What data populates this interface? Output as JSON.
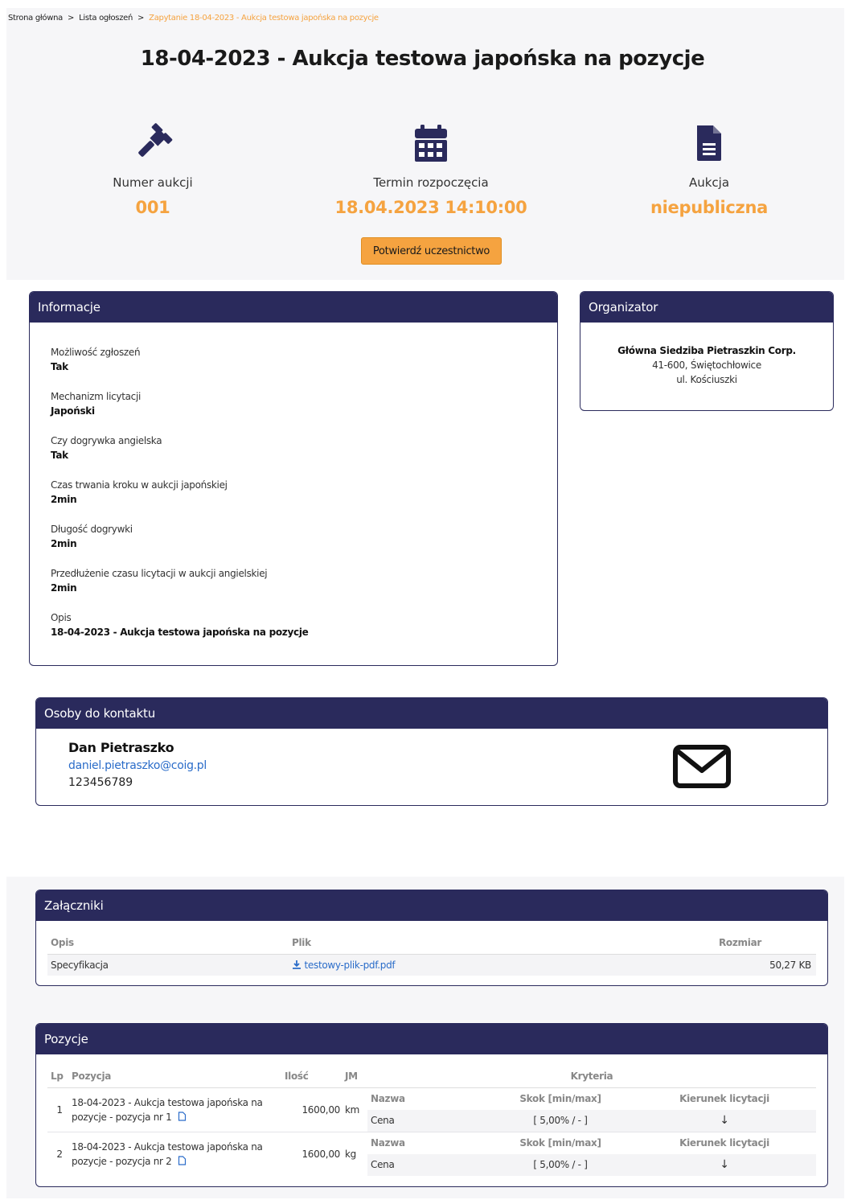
{
  "breadcrumb": {
    "home": "Strona główna",
    "list": "Lista ogłoszeń",
    "current": "Zapytanie 18-04-2023 - Aukcja testowa japońska na pozycje",
    "sep": ">"
  },
  "title": "18-04-2023 - Aukcja testowa japońska na pozycje",
  "stats": {
    "number_label": "Numer aukcji",
    "number_value": "001",
    "start_label": "Termin rozpoczęcia",
    "start_value": "18.04.2023 14:10:00",
    "type_label": "Aukcja",
    "type_value": "niepubliczna"
  },
  "confirm_button": "Potwierdź uczestnictwo",
  "info": {
    "header": "Informacje",
    "items": [
      {
        "label": "Możliwość zgłoszeń",
        "value": "Tak"
      },
      {
        "label": "Mechanizm licytacji",
        "value": "Japoński"
      },
      {
        "label": "Czy dogrywka angielska",
        "value": "Tak"
      },
      {
        "label": "Czas trwania kroku w aukcji japońskiej",
        "value": "2min"
      },
      {
        "label": "Długość dogrywki",
        "value": "2min"
      },
      {
        "label": "Przedłużenie czasu licytacji w aukcji angielskiej",
        "value": "2min"
      },
      {
        "label": "Opis",
        "value": "18-04-2023 - Aukcja testowa japońska na pozycje"
      }
    ]
  },
  "organizer": {
    "header": "Organizator",
    "name": "Główna Siedziba Pietraszkin Corp.",
    "city": "41-600, Świętochłowice",
    "street": "ul. Kościuszki"
  },
  "contacts": {
    "header": "Osoby do kontaktu",
    "name": "Dan Pietraszko",
    "email": "daniel.pietraszko@coig.pl",
    "phone": "123456789"
  },
  "attachments": {
    "header": "Załączniki",
    "columns": [
      "Opis",
      "Plik",
      "Rozmiar"
    ],
    "rows": [
      {
        "desc": "Specyfikacja",
        "file": "testowy-plik-pdf.pdf",
        "size": "50,27 KB"
      }
    ]
  },
  "positions": {
    "header": "Pozycje",
    "columns": [
      "Lp",
      "Pozycja",
      "Ilość",
      "JM",
      "Kryteria"
    ],
    "criteria_columns": [
      "Nazwa",
      "Skok [min/max]",
      "Kierunek licytacji"
    ],
    "rows": [
      {
        "lp": "1",
        "name_line1": "18-04-2023 - Aukcja testowa japońska na",
        "name_line2": "pozycje - pozycja nr 1",
        "qty": "1600,00",
        "unit": "km",
        "crit_name": "Cena",
        "crit_step": "[ 5,00% / - ]",
        "crit_dir": "↓"
      },
      {
        "lp": "2",
        "name_line1": "18-04-2023 - Aukcja testowa japońska na",
        "name_line2": "pozycje - pozycja nr 2",
        "qty": "1600,00",
        "unit": "kg",
        "crit_name": "Cena",
        "crit_step": "[ 5,00% / - ]",
        "crit_dir": "↓"
      }
    ]
  },
  "colors": {
    "navy": "#2a2a5c",
    "accent": "#f5a340",
    "link": "#2a6cc9"
  }
}
